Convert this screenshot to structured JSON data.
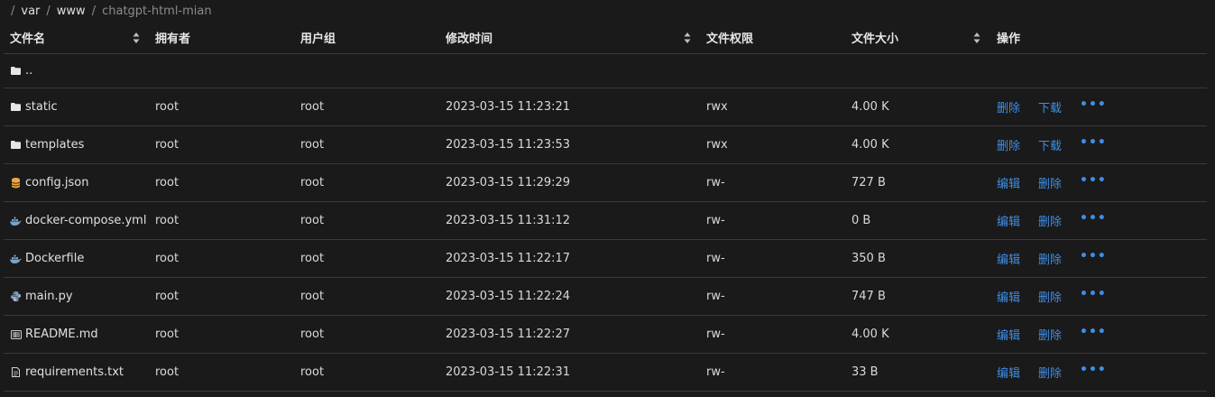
{
  "breadcrumb": {
    "separator": "/",
    "items": [
      "var",
      "www",
      "chatgpt-html-mian"
    ]
  },
  "table": {
    "columns": {
      "name": "文件名",
      "owner": "拥有者",
      "group": "用户组",
      "mtime": "修改时间",
      "perm": "文件权限",
      "size": "文件大小",
      "ops": "操作"
    },
    "parent_dir": "..",
    "rows": [
      {
        "name": "static",
        "icon": "folder-icon",
        "owner": "root",
        "group": "root",
        "mtime": "2023-03-15 11:23:21",
        "perm": "rwx",
        "size": "4.00 K",
        "op1": "删除",
        "op2": "下载",
        "more": "•••"
      },
      {
        "name": "templates",
        "icon": "folder-icon",
        "owner": "root",
        "group": "root",
        "mtime": "2023-03-15 11:23:53",
        "perm": "rwx",
        "size": "4.00 K",
        "op1": "删除",
        "op2": "下载",
        "more": "•••"
      },
      {
        "name": "config.json",
        "icon": "database-icon",
        "owner": "root",
        "group": "root",
        "mtime": "2023-03-15 11:29:29",
        "perm": "rw-",
        "size": "727 B",
        "op1": "编辑",
        "op2": "删除",
        "more": "•••"
      },
      {
        "name": "docker-compose.yml",
        "icon": "docker-icon",
        "owner": "root",
        "group": "root",
        "mtime": "2023-03-15 11:31:12",
        "perm": "rw-",
        "size": "0 B",
        "op1": "编辑",
        "op2": "删除",
        "more": "•••"
      },
      {
        "name": "Dockerfile",
        "icon": "docker-icon",
        "owner": "root",
        "group": "root",
        "mtime": "2023-03-15 11:22:17",
        "perm": "rw-",
        "size": "350 B",
        "op1": "编辑",
        "op2": "删除",
        "more": "•••"
      },
      {
        "name": "main.py",
        "icon": "python-icon",
        "owner": "root",
        "group": "root",
        "mtime": "2023-03-15 11:22:24",
        "perm": "rw-",
        "size": "747 B",
        "op1": "编辑",
        "op2": "删除",
        "more": "•••"
      },
      {
        "name": "README.md",
        "icon": "markdown-icon",
        "owner": "root",
        "group": "root",
        "mtime": "2023-03-15 11:22:27",
        "perm": "rw-",
        "size": "4.00 K",
        "op1": "编辑",
        "op2": "删除",
        "more": "•••"
      },
      {
        "name": "requirements.txt",
        "icon": "text-file-icon",
        "owner": "root",
        "group": "root",
        "mtime": "2023-03-15 11:22:31",
        "perm": "rw-",
        "size": "33 B",
        "op1": "编辑",
        "op2": "删除",
        "more": "•••"
      }
    ]
  },
  "colors": {
    "background": "#1a1a1a",
    "link": "#3f8ee8",
    "json_icon": "#f0a73a",
    "docker_icon": "#7aa3c8",
    "python_icon": "#7a9cc6"
  }
}
